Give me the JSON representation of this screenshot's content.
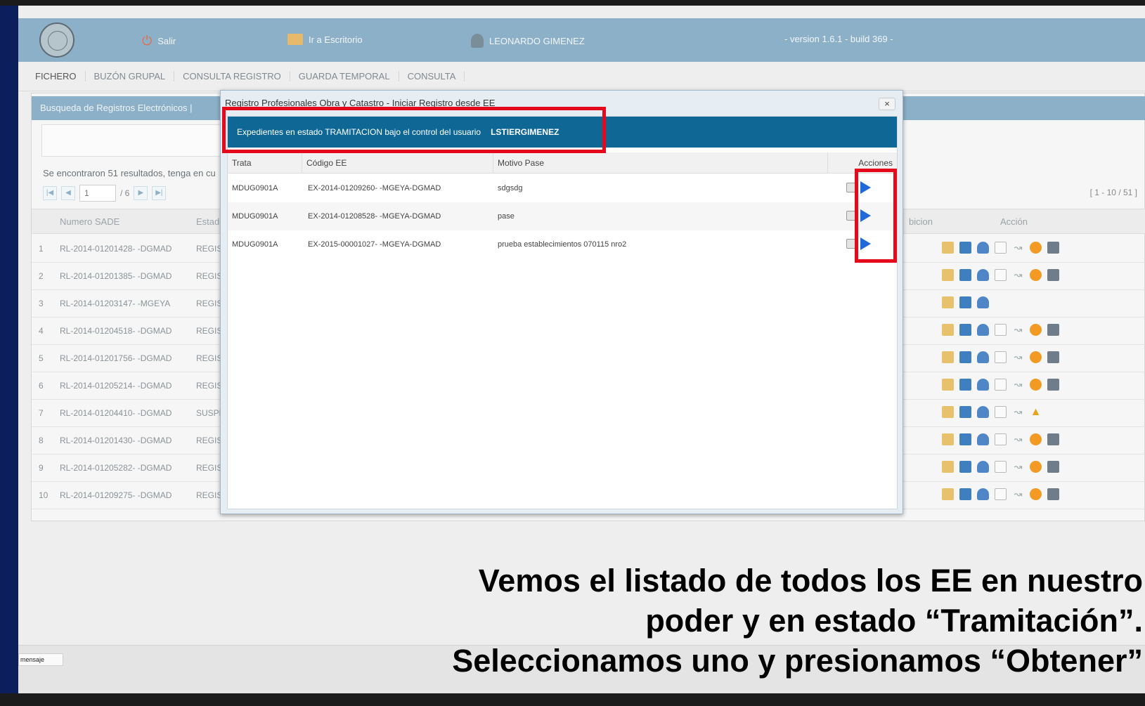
{
  "header": {
    "logout_label": "Salir",
    "desk_label": "Ir a Escritorio",
    "user_name": "LEONARDO GIMENEZ",
    "version": "- version 1.6.1 - build 369 -"
  },
  "nav_tabs": [
    "FICHERO",
    "BUZÓN GRUPAL",
    "CONSULTA REGISTRO",
    "GUARDA TEMPORAL",
    "CONSULTA"
  ],
  "background_panel": {
    "title": "Busqueda de Registros Electrónicos   |",
    "results_text": "Se encontraron 51 resultados, tenga en cu",
    "page_input": "1",
    "page_total": "/ 6",
    "range": "[ 1 - 10 / 51 ]",
    "columns": {
      "sade": "Numero SADE",
      "estado": "Estado",
      "ubicacion": "bicion",
      "accion": "Acción"
    },
    "rows": [
      {
        "n": "1",
        "sade": "RL-2014-01201428- -DGMAD",
        "estado": "REGIS",
        "actions": "full"
      },
      {
        "n": "2",
        "sade": "RL-2014-01201385- -DGMAD",
        "estado": "REGIS",
        "actions": "full"
      },
      {
        "n": "3",
        "sade": "RL-2014-01203147- -MGEYA",
        "estado": "REGIS",
        "actions": "short"
      },
      {
        "n": "4",
        "sade": "RL-2014-01204518- -DGMAD",
        "estado": "REGIS",
        "actions": "full"
      },
      {
        "n": "5",
        "sade": "RL-2014-01201756- -DGMAD",
        "estado": "REGIS",
        "actions": "full"
      },
      {
        "n": "6",
        "sade": "RL-2014-01205214- -DGMAD",
        "estado": "REGIS",
        "actions": "full"
      },
      {
        "n": "7",
        "sade": "RL-2014-01204410- -DGMAD",
        "estado": "SUSPE",
        "actions": "warn"
      },
      {
        "n": "8",
        "sade": "RL-2014-01201430- -DGMAD",
        "estado": "REGIS",
        "actions": "full"
      },
      {
        "n": "9",
        "sade": "RL-2014-01205282- -DGMAD",
        "estado": "REGIS",
        "actions": "full"
      },
      {
        "n": "10",
        "sade": "RL-2014-01209275- -DGMAD",
        "estado": "REGIS",
        "actions": "full"
      }
    ]
  },
  "modal": {
    "title": "Registro Profesionales Obra y Catastro - Iniciar Registro desde EE",
    "close_label": "×",
    "banner_text": "Expedientes en estado TRAMITACION bajo el control del usuario",
    "banner_user": "LSTIERGIMENEZ",
    "columns": {
      "trata": "Trata",
      "codigo": "Código EE",
      "motivo": "Motivo Pase",
      "acciones": "Acciones"
    },
    "rows": [
      {
        "trata": "MDUG0901A",
        "codigo": "EX-2014-01209260- -MGEYA-DGMAD",
        "motivo": "sdgsdg"
      },
      {
        "trata": "MDUG0901A",
        "codigo": "EX-2014-01208528- -MGEYA-DGMAD",
        "motivo": "pase"
      },
      {
        "trata": "MDUG0901A",
        "codigo": "EX-2015-00001027- -MGEYA-DGMAD",
        "motivo": "prueba establecimientos 070115 nro2"
      }
    ]
  },
  "caption": {
    "line1": "Vemos el listado de todos los EE en nuestro",
    "line2": "poder y en estado “Tramitación”.",
    "line3": "Seleccionamos uno y presionamos “Obtener”"
  },
  "footer_widget": "mensaje"
}
